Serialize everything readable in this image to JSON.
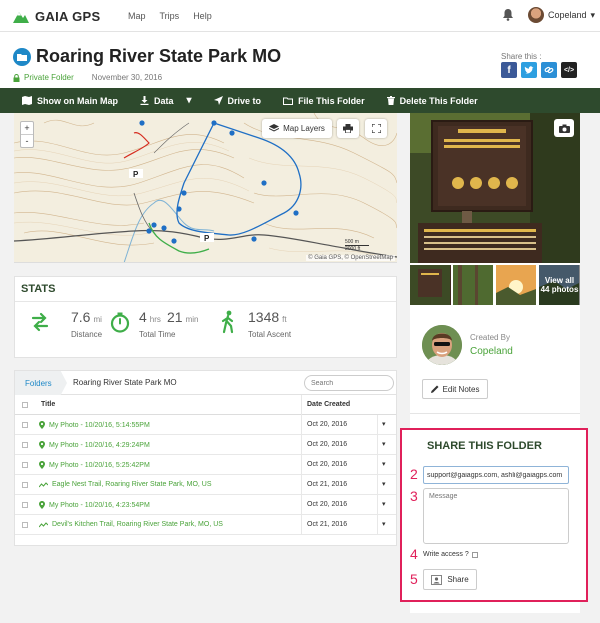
{
  "header": {
    "brand": "GAIA GPS",
    "nav": [
      "Map",
      "Trips",
      "Help"
    ],
    "user_name": "Copeland"
  },
  "page": {
    "title": "Roaring River State Park MO",
    "privacy": "Private Folder",
    "date": "November 30, 2016",
    "share_this": "Share this :"
  },
  "toolbar": {
    "show_on_map": "Show on Main Map",
    "data": "Data",
    "drive_to": "Drive to",
    "file_folder": "File This Folder",
    "delete_folder": "Delete This Folder"
  },
  "map": {
    "zoom_in": "+",
    "zoom_out": "-",
    "layers_label": "Map Layers",
    "scale_top": "500 m",
    "scale_bottom": "2000 ft",
    "attribution": "© Gaia GPS, © OpenStreetMap",
    "marker_label": "P"
  },
  "photos": {
    "view_all": "View all",
    "count": "44 photos"
  },
  "creator": {
    "label": "Created By",
    "name": "Copeland",
    "edit_notes": "Edit Notes"
  },
  "share": {
    "title": "SHARE THIS FOLDER",
    "emails": "support@gaiagps.com, ashli@gaiagps.com",
    "message_placeholder": "Message",
    "write_access": "Write access ?",
    "share_button": "Share",
    "step_numbers": [
      "2",
      "3",
      "4",
      "5"
    ]
  },
  "stats": {
    "title": "STATS",
    "distance_value": "7.6",
    "distance_unit": "mi",
    "distance_label": "Distance",
    "time_hours": "4",
    "time_hours_unit": "hrs",
    "time_minutes": "21",
    "time_minutes_unit": "min",
    "time_label": "Total Time",
    "ascent_value": "1348",
    "ascent_unit": "ft",
    "ascent_label": "Total Ascent"
  },
  "table": {
    "crumb_root": "Folders",
    "crumb_current": "Roaring River State Park MO",
    "search_placeholder": "Search",
    "col_title": "Title",
    "col_date": "Date Created",
    "rows": [
      {
        "title": "My Photo - 10/20/16, 5:14:55PM",
        "date": "Oct 20, 2016",
        "kind": "photo"
      },
      {
        "title": "My Photo - 10/20/16, 4:29:24PM",
        "date": "Oct 20, 2016",
        "kind": "photo"
      },
      {
        "title": "My Photo - 10/20/16, 5:25:42PM",
        "date": "Oct 20, 2016",
        "kind": "photo"
      },
      {
        "title": "Eagle Nest Trail, Roaring River State Park, MO, US",
        "date": "Oct 21, 2016",
        "kind": "track"
      },
      {
        "title": "My Photo - 10/20/16, 4:23:54PM",
        "date": "Oct 20, 2016",
        "kind": "photo"
      },
      {
        "title": "Devil's Kitchen Trail, Roaring River State Park, MO, US",
        "date": "Oct 21, 2016",
        "kind": "track"
      }
    ]
  },
  "colors": {
    "brand_green": "#2e4a2d",
    "link_green": "#4aa33a",
    "highlight": "#e0205a"
  }
}
